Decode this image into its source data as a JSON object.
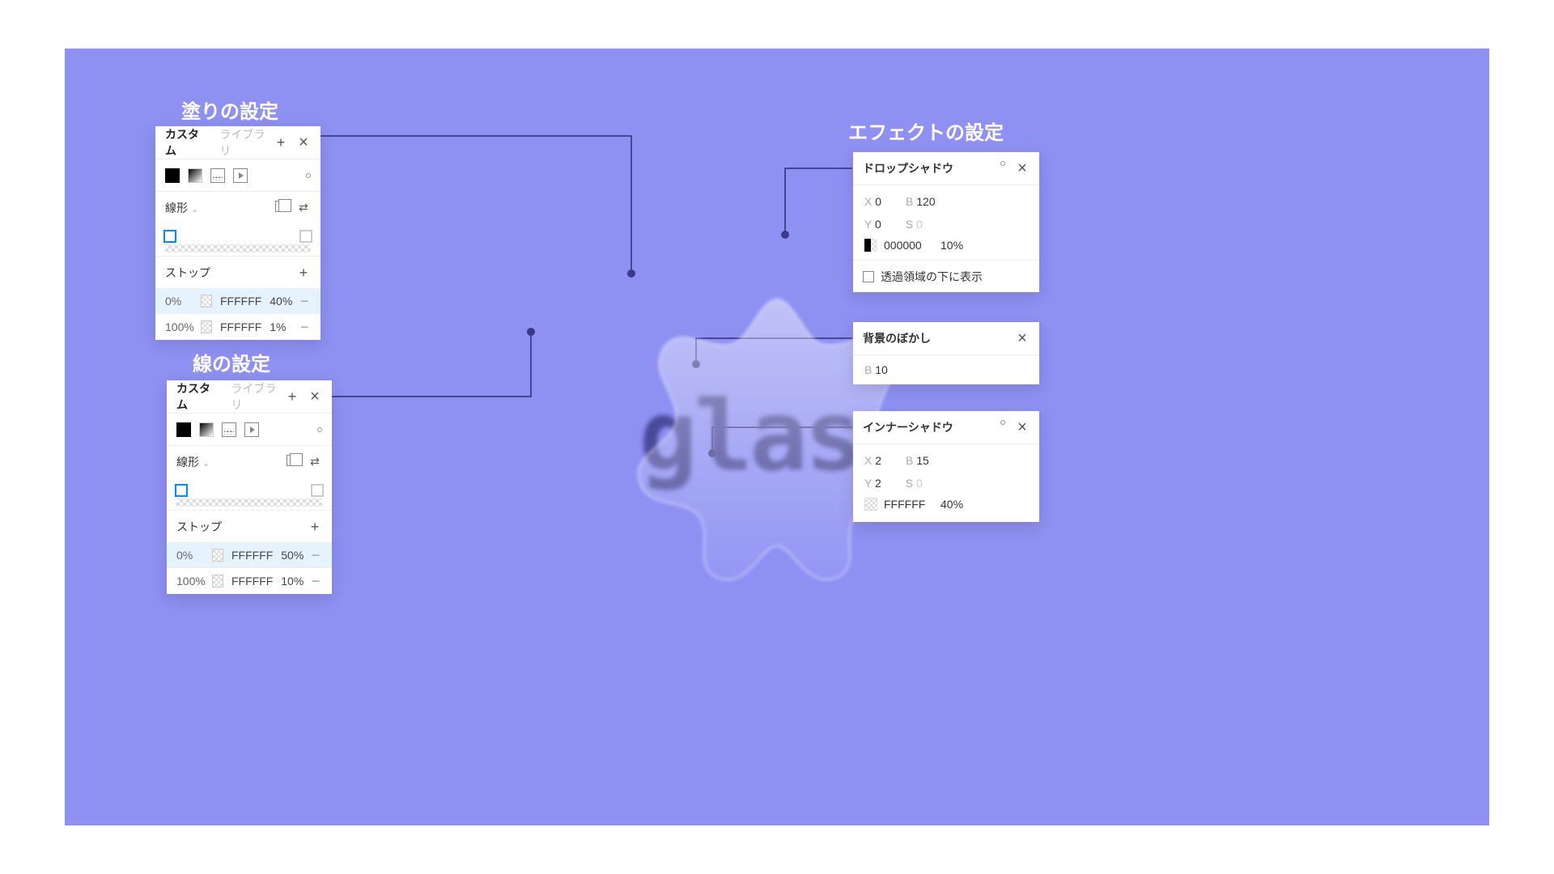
{
  "sections": {
    "fill": {
      "title": "塗りの設定"
    },
    "stroke": {
      "title": "線の設定"
    },
    "effect": {
      "title": "エフェクトの設定"
    }
  },
  "gradient_panel": {
    "tabs": {
      "custom": "カスタム",
      "library": "ライブラリ"
    },
    "type_label": "線形",
    "stops_header": "ストップ"
  },
  "fill_panel": {
    "stops": [
      {
        "pos": "0%",
        "hex": "FFFFFF",
        "alpha": "40%"
      },
      {
        "pos": "100%",
        "hex": "FFFFFF",
        "alpha": "1%"
      }
    ]
  },
  "stroke_panel": {
    "stops": [
      {
        "pos": "0%",
        "hex": "FFFFFF",
        "alpha": "50%"
      },
      {
        "pos": "100%",
        "hex": "FFFFFF",
        "alpha": "10%"
      }
    ]
  },
  "effects": {
    "drop_shadow": {
      "title": "ドロップシャドウ",
      "x_label": "X",
      "x": "0",
      "y_label": "Y",
      "y": "0",
      "b_label": "B",
      "b": "120",
      "s_label": "S",
      "s": "0",
      "color": "000000",
      "alpha": "10%",
      "show_behind_label": "透過領域の下に表示"
    },
    "bg_blur": {
      "title": "背景のぼかし",
      "b_label": "B",
      "b": "10"
    },
    "inner_shadow": {
      "title": "インナーシャドウ",
      "x_label": "X",
      "x": "2",
      "y_label": "Y",
      "y": "2",
      "b_label": "B",
      "b": "15",
      "s_label": "S",
      "s": "0",
      "color": "FFFFFF",
      "alpha": "40%"
    }
  },
  "center_text": "glass"
}
